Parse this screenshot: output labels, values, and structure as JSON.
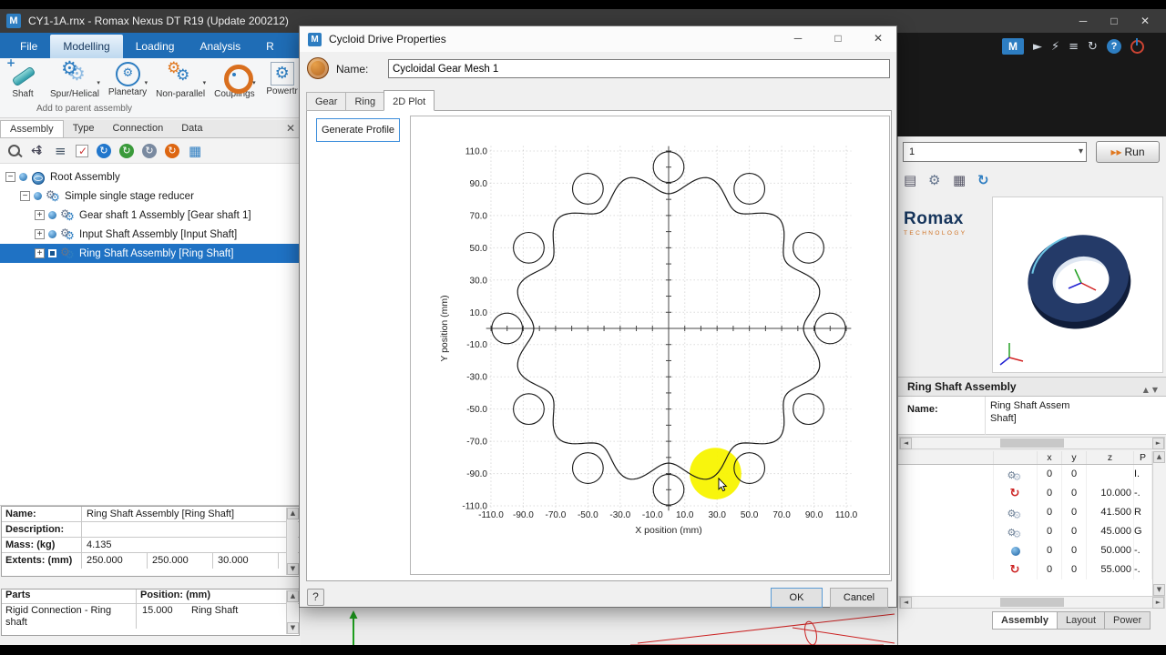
{
  "window": {
    "title": "CY1-1A.rnx - Romax Nexus DT R19 (Update 200212)",
    "minimize": "─",
    "maximize": "□",
    "close": "✕",
    "logo_letter": "M"
  },
  "topbar": {
    "icons": [
      {
        "name": "romax-logo-icon",
        "type": "logo",
        "glyph": "M"
      },
      {
        "name": "pointer-icon",
        "type": "glyph",
        "glyph": "►"
      },
      {
        "name": "lightning-icon",
        "type": "glyph",
        "glyph": "⚡"
      },
      {
        "name": "list-icon",
        "type": "glyph",
        "glyph": "≡"
      },
      {
        "name": "refresh-icon",
        "type": "glyph",
        "glyph": "↻"
      },
      {
        "name": "help-icon",
        "type": "help",
        "glyph": "?"
      },
      {
        "name": "power-icon",
        "type": "power",
        "glyph": ""
      }
    ]
  },
  "ribbon": {
    "tabs": [
      "File",
      "Modelling",
      "Loading",
      "Analysis",
      "R"
    ],
    "selected_tab": "Modelling",
    "buttons": [
      {
        "label": "Shaft",
        "icon": "shaft-icon",
        "dropdown": false
      },
      {
        "label": "Spur/Helical",
        "icon": "spur-helical-gear-icon",
        "dropdown": true
      },
      {
        "label": "Planetary",
        "icon": "planetary-gear-icon",
        "dropdown": true
      },
      {
        "label": "Non-parallel",
        "icon": "non-parallel-gear-icon",
        "dropdown": true
      },
      {
        "label": "Couplings",
        "icon": "couplings-icon",
        "dropdown": true
      },
      {
        "label": "Powertr",
        "icon": "powertrain-icon",
        "dropdown": false
      }
    ],
    "caption": "Add to parent assembly"
  },
  "left_panel": {
    "tabs": [
      "Assembly",
      "Type",
      "Connection",
      "Data"
    ],
    "selected_tab": "Assembly",
    "close": "✕",
    "toolbar_icons": [
      "search-icon",
      "move-icon",
      "list-icon",
      "checkmark-icon",
      "orbit-blue-icon",
      "orbit-green-icon",
      "orbit-gray-icon",
      "orbit-orange-icon",
      "table-icon"
    ],
    "tree": [
      {
        "label": "Root Assembly",
        "indent": 0,
        "expanded": true,
        "icon": "globe-icon",
        "selected": false
      },
      {
        "label": "Simple single stage reducer",
        "indent": 1,
        "expanded": true,
        "icon": "assembly-icon",
        "selected": false
      },
      {
        "label": "Gear shaft 1 Assembly [Gear shaft 1]",
        "indent": 2,
        "expanded": false,
        "icon": "assembly-icon",
        "selected": false
      },
      {
        "label": "Input Shaft Assembly [Input Shaft]",
        "indent": 2,
        "expanded": false,
        "icon": "assembly-icon",
        "selected": false
      },
      {
        "label": "Ring Shaft Assembly [Ring Shaft]",
        "indent": 2,
        "expanded": false,
        "icon": "assembly-icon",
        "selected": true
      }
    ],
    "properties_rows": [
      {
        "label": "Name:",
        "values": [
          "Ring Shaft Assembly [Ring Shaft]"
        ]
      },
      {
        "label": "Description:",
        "values": [
          ""
        ]
      },
      {
        "label": "Mass: (kg)",
        "values": [
          "4.135"
        ]
      },
      {
        "label": "Extents: (mm)",
        "values": [
          "250.000",
          "250.000",
          "30.000"
        ]
      }
    ],
    "parts": {
      "headers": [
        "Parts",
        "Position: (mm)"
      ],
      "rows": [
        {
          "part": "Rigid Connection - Ring shaft",
          "position": "15.000",
          "name": "Ring Shaft"
        }
      ]
    }
  },
  "dialog": {
    "title": "Cycloid Drive Properties",
    "name_label": "Name:",
    "name_value": "Cycloidal Gear Mesh 1",
    "tabs": [
      "Gear",
      "Ring",
      "2D Plot"
    ],
    "selected_tab": "2D Plot",
    "generate_button": "Generate Profile",
    "help_button": "?",
    "ok_button": "OK",
    "cancel_button": "Cancel"
  },
  "chart_data": {
    "type": "line",
    "title": "",
    "xlabel": "X position (mm)",
    "ylabel": "Y position (mm)",
    "xlim": [
      -120,
      120
    ],
    "ylim": [
      -120,
      120
    ],
    "xticks": [
      -110,
      -90,
      -70,
      -50,
      -30,
      -10,
      10,
      30,
      50,
      70,
      90,
      110
    ],
    "yticks": [
      -110,
      -90,
      -70,
      -50,
      -30,
      -10,
      10,
      30,
      50,
      70,
      90,
      110
    ],
    "grid": "dotted",
    "pins": {
      "count": 12,
      "center_radius": 100,
      "pin_radius": 9.5,
      "start_angle_deg": 90
    },
    "cycloid_profile": {
      "lobes": 12,
      "mean_radius": 90,
      "amplitude": 6.5
    },
    "highlight": {
      "x": 29,
      "y": -90,
      "radius_mm": 16,
      "color": "#f8f400"
    },
    "cursor": {
      "x": 31,
      "y": -93
    }
  },
  "right_panel": {
    "run_combo_value": "1",
    "run_icon": "▸▸",
    "run_button": "Run",
    "small_icons": [
      "window-icon",
      "gear-icon",
      "grid-icon",
      "refresh-icon"
    ],
    "brand": {
      "name": "Romax",
      "sub": "TECHNOLOGY"
    },
    "assembly_header": "Ring Shaft Assembly",
    "name_label": "Name:",
    "name_value_line1": "Ring Shaft Assem",
    "name_value_line2": "Shaft]",
    "table": {
      "headers": [
        "x",
        "y",
        "z",
        "P"
      ],
      "rows": [
        {
          "icon": "gear-pair-icon",
          "x": "0",
          "y": "0",
          "z": "",
          "p": "I."
        },
        {
          "icon": "rotation-red-icon",
          "x": "0",
          "y": "0",
          "z": "10.000",
          "p": "-."
        },
        {
          "icon": "gear-pair-icon",
          "x": "0",
          "y": "0",
          "z": "41.500",
          "p": "R"
        },
        {
          "icon": "gear-pair-icon",
          "x": "0",
          "y": "0",
          "z": "45.000",
          "p": "G"
        },
        {
          "icon": "sphere-blue-icon",
          "x": "0",
          "y": "0",
          "z": "50.000",
          "p": "-."
        },
        {
          "icon": "rotation-red-icon",
          "x": "0",
          "y": "0",
          "z": "55.000",
          "p": "-."
        }
      ]
    },
    "bottom_tabs": [
      "Assembly",
      "Layout",
      "Power"
    ],
    "selected_bottom_tab": "Assembly"
  }
}
